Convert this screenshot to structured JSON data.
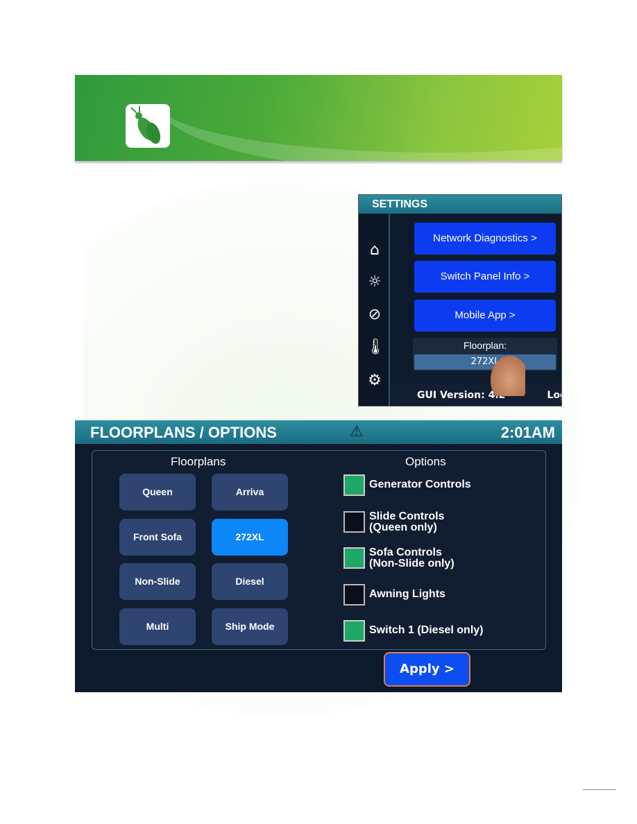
{
  "settings": {
    "title": "SETTINGS",
    "sidebar_icons": [
      "home-icon",
      "lightbulb-icon",
      "power-icon",
      "thermometer-icon",
      "gear-icon"
    ],
    "buttons": [
      "Network Diagnostics >",
      "Switch Panel Info >",
      "Mobile App >"
    ],
    "floorplan_label": "Floorplan:",
    "floorplan_value": "272XL",
    "gui_version": "GUI Version: 4.2",
    "login": "Logi"
  },
  "floorplans": {
    "title": "FLOORPLANS / OPTIONS",
    "time": "2:01AM",
    "floorplans_heading": "Floorplans",
    "options_heading": "Options",
    "buttons": [
      {
        "label": "Queen",
        "selected": false
      },
      {
        "label": "Arriva",
        "selected": false
      },
      {
        "label": "Front Sofa",
        "selected": false
      },
      {
        "label": "272XL",
        "selected": true
      },
      {
        "label": "Non-Slide",
        "selected": false
      },
      {
        "label": "Diesel",
        "selected": false
      },
      {
        "label": "Multi",
        "selected": false
      },
      {
        "label": "Ship Mode",
        "selected": false
      }
    ],
    "options": [
      {
        "line1": "Generator Controls",
        "line2": "",
        "checked": true
      },
      {
        "line1": "Slide Controls",
        "line2": "(Queen only)",
        "checked": false
      },
      {
        "line1": "Sofa Controls",
        "line2": "(Non-Slide only)",
        "checked": true
      },
      {
        "line1": "Awning Lights",
        "line2": "",
        "checked": false
      },
      {
        "line1": "Switch 1 (Diesel only)",
        "line2": "",
        "checked": true
      }
    ],
    "apply": "Apply >"
  },
  "colors": {
    "banner": "#4caa3a",
    "checked": "#1fa766",
    "selected": "#0d86f8",
    "button": "#0d3cf0"
  }
}
